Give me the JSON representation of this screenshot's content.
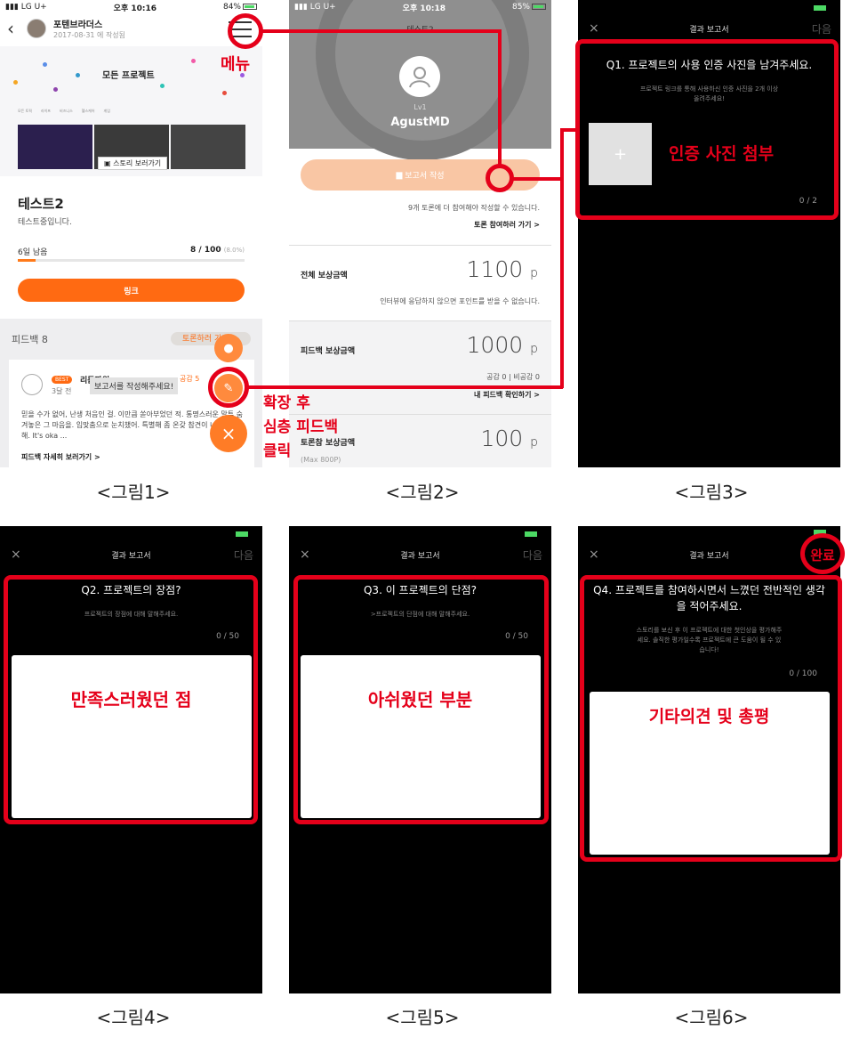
{
  "captions": [
    "<그림1>",
    "<그림2>",
    "<그림3>",
    "<그림4>",
    "<그림5>",
    "<그림6>"
  ],
  "annotations": {
    "menu": "메뉴",
    "expand": [
      "확장 후",
      "심층 피드백",
      "클릭"
    ],
    "attach": "인증 사진 첨부",
    "satisfied": "만족스러웠던 점",
    "regret": "아쉬웠던 부분",
    "other": "기타의견 및 총평",
    "done": "완료"
  },
  "p1": {
    "status": {
      "carrier": "LG U+",
      "time": "오후 10:16",
      "battery": "84%"
    },
    "nav": {
      "name": "포텐브라더스",
      "date": "2017-08-31 에 작성됨"
    },
    "banner_title": "모든 프로젝트",
    "banner_tabs": [
      "모든 토픽",
      "라이프",
      "비즈니스",
      "헬스케어",
      "게임"
    ],
    "story_button": "스토리 보러가기",
    "project_title": "테스트2",
    "project_desc": "테스트중입니다.",
    "days_left": "6일 남음",
    "progress": "8 / 100",
    "progress_pct": "(8.0%)",
    "progress_fraction": 0.08,
    "link_button": "링크",
    "feedback_header": "피드백 8",
    "debate_button": "토론하러 가기",
    "card": {
      "badge": "BEST",
      "user": "리듬파워",
      "time": "3달 전",
      "likes": "공감 5",
      "text": "믿을 수가 없어, 난생 처음인 걸. 이만큼 쏟아부었던 적. 통명스러운 말투 숨겨놓은 그 마음을. 입맞춤으로 눈치챘어. 특별해 좀 온갖 참견이 너만 지독해. It's oka ...",
      "more": "피드백 자세히 보러가기 >"
    },
    "tooltip": "보고서를 작성해주세요!"
  },
  "p2": {
    "status": {
      "carrier": "LG U+",
      "time": "오후 10:18",
      "battery": "85%"
    },
    "title": "테스트2",
    "level": "Lv1",
    "username": "AgustMD",
    "report_button": "보고서 작성",
    "need_more": "9개 토론에 더 참여해야 작성할 수 있습니다.",
    "go_debate": "토론 참여하러 가기 >",
    "rows": [
      {
        "label": "전체 보상금액",
        "amount": "1100",
        "unit": "p",
        "note": "인터뷰에 응답하지 않으면 포인트를 받을 수 없습니다."
      },
      {
        "label": "피드백 보상금액",
        "amount": "1000",
        "unit": "p",
        "note": "공감 0  |  비공감 0",
        "link": "내 피드백 확인하기 >"
      },
      {
        "label": "토론참 보상금액",
        "amount": "100",
        "unit": "p",
        "sub": "(Max 800P)"
      }
    ]
  },
  "dark": {
    "close": "×",
    "title": "결과 보고서",
    "next": "다음"
  },
  "p3": {
    "question": "Q1. 프로젝트의 사용 인증 사진을 남겨주세요.",
    "hint": [
      "프로젝트 링크를 통해 사용하신 인증 사진을 2개 이상",
      "올려주세요!"
    ],
    "plus": "+",
    "counter": "0 / 2"
  },
  "p4": {
    "question": "Q2. 프로젝트의 장점?",
    "hint": "프로젝트의 장점에 대해 말해주세요.",
    "counter": "0 / 50"
  },
  "p5": {
    "question": "Q3. 이 프로젝트의 단점?",
    "hint": ">프로젝트의 단점에 대해 말해주세요.",
    "counter": "0 / 50"
  },
  "p6": {
    "question": [
      "Q4. 프로젝트를 참여하시면서 느꼈던 전반적인 생각",
      "을 적어주세요."
    ],
    "hint": [
      "스토리를 보신 후 이 프로젝트에 대한 첫인상을 평가해주",
      "세요. 솔직한 평가일수록 프로젝트에 큰 도움이 될 수 있",
      "습니다!"
    ],
    "counter": "0 / 100"
  },
  "colors": {
    "accent": "#ff6a12",
    "annotation": "#e5001a",
    "dark_bg": "#000000"
  }
}
